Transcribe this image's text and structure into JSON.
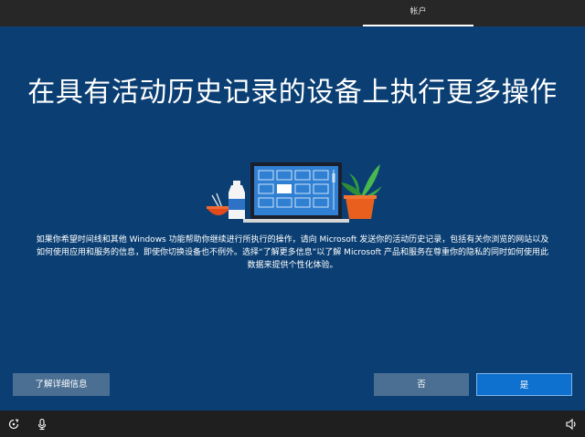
{
  "header": {
    "tab_label": "帐户"
  },
  "main": {
    "title": "在具有活动历史记录的设备上执行更多操作",
    "description_lines": [
      "如果你希望时间线和其他 Windows 功能帮助你继续进行所执行的操作，请向 Microsoft 发送你的活动历史记录，包括有关你浏览的网站以及",
      "如何使用应用和服务的信息，即使你切换设备也不例外。选择“了解更多信息”以了解 Microsoft 产品和服务在尊重你的隐私的同时如何使用此",
      "数据来提供个性化体验。"
    ]
  },
  "buttons": {
    "learn_more": "了解详细信息",
    "no": "否",
    "yes": "是"
  },
  "bottom_bar": {
    "icons": [
      "ease-of-access-icon",
      "microphone-icon",
      "volume-icon"
    ]
  },
  "colors": {
    "background": "#0b3f73",
    "topbar": "#272727",
    "button_secondary": "#4a6f93",
    "button_primary": "#0f71cf"
  }
}
